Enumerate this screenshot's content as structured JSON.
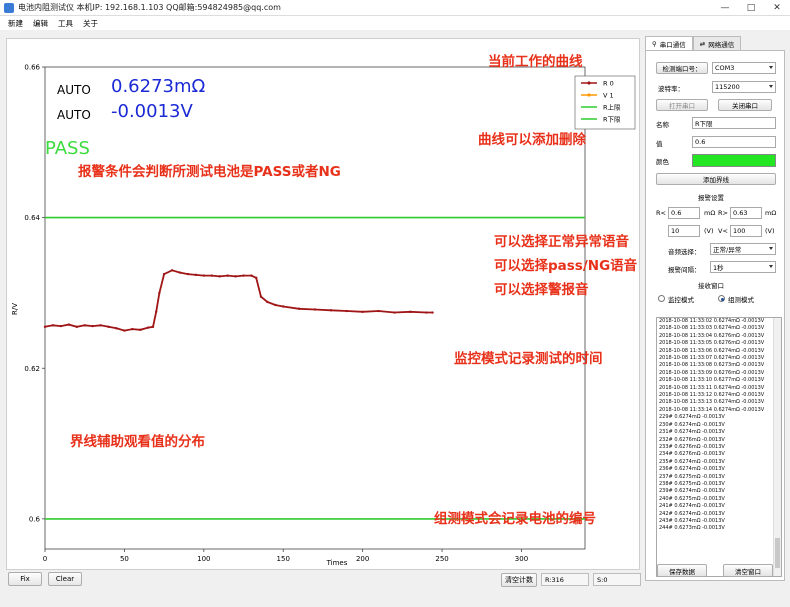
{
  "window": {
    "title": "电池内阻测试仪  本机IP: 192.168.1.103  QQ邮箱:594824985@qq.com",
    "controls": [
      "—",
      "□",
      "✕"
    ]
  },
  "menu": [
    "新建",
    "编辑",
    "工具",
    "关于"
  ],
  "readout": {
    "mode1": "AUTO",
    "value1": "0.6273mΩ",
    "mode2": "AUTO",
    "value2": "-0.0013V",
    "status": "PASS",
    "status_color": "#3ddc3d",
    "value_color": "#1c2ad6"
  },
  "legend": [
    "R 0",
    "V 1",
    "R上限",
    "R下限"
  ],
  "chart_data": {
    "type": "line",
    "xlabel": "Times",
    "ylabel": "R/V",
    "xlim": [
      0,
      340
    ],
    "ylim": [
      0.596,
      0.66
    ],
    "xticks": [
      "0",
      "50",
      "100",
      "150",
      "200",
      "250",
      "300"
    ],
    "yticks": [
      "0.66",
      "0.64",
      "0.62",
      "0.6"
    ],
    "series": [
      {
        "name": "R 0",
        "color": "#a01515",
        "x": [
          0,
          5,
          10,
          15,
          20,
          25,
          30,
          35,
          40,
          45,
          50,
          55,
          60,
          65,
          68,
          70,
          72,
          75,
          80,
          85,
          90,
          95,
          100,
          105,
          110,
          115,
          120,
          125,
          130,
          133,
          136,
          140,
          145,
          150,
          160,
          170,
          180,
          190,
          200,
          210,
          220,
          230,
          240,
          244
        ],
        "y": [
          0.6255,
          0.6257,
          0.6256,
          0.6258,
          0.6255,
          0.6257,
          0.6256,
          0.6257,
          0.6255,
          0.6253,
          0.625,
          0.6252,
          0.6251,
          0.6254,
          0.6255,
          0.6275,
          0.63,
          0.6325,
          0.633,
          0.6327,
          0.6325,
          0.6324,
          0.6323,
          0.6323,
          0.6322,
          0.6323,
          0.6322,
          0.6323,
          0.6323,
          0.632,
          0.6295,
          0.6288,
          0.6284,
          0.6282,
          0.6279,
          0.6278,
          0.6277,
          0.6276,
          0.6275,
          0.6276,
          0.6274,
          0.6275,
          0.6274,
          0.6274
        ]
      },
      {
        "name": "V 1",
        "color": "#ff9900",
        "x": [],
        "y": []
      },
      {
        "name": "R上限",
        "color": "#2ecc2e",
        "x": [
          0,
          340
        ],
        "y": [
          0.64,
          0.64
        ]
      },
      {
        "name": "R下限",
        "color": "#2ecc2e",
        "x": [
          0,
          340
        ],
        "y": [
          0.6,
          0.6
        ]
      }
    ],
    "grid": false,
    "legend_position": "top-right"
  },
  "annotations": {
    "curve": "当前工作的曲线",
    "add_remove": "曲线可以添加删除",
    "alarm": "报警条件会判断所测试电池是PASS或者NG",
    "voice1": "可以选择正常异常语音",
    "voice2": "可以选择pass/NG语音",
    "voice3": "可以选择警报音",
    "monitor": "监控模式记录测试的时间",
    "boundary": "界线辅助观看值的分布",
    "group": "组测模式会记录电池的编号"
  },
  "bottom": {
    "fix": "Fix",
    "clear": "Clear",
    "clear_count": "清空计数",
    "r_count": "R:316",
    "s_count": "S:0"
  },
  "right": {
    "tab_serial": "串口通信",
    "tab_net": "网络通信",
    "detect_port_label": "检测端口号：",
    "port_value": "COM3",
    "baud_label": "波特率：",
    "baud_value": "115200",
    "open_port": "打开串口",
    "close_port": "关闭串口",
    "name_label": "名称",
    "name_value": "R下限",
    "value_label": "值",
    "value_value": "0.6",
    "color_label": "颜色",
    "color_value": "#22e622",
    "add_boundary": "添加界线",
    "alarm_settings": "报警设置",
    "r_lt": "R<",
    "r_lt_value": "0.6",
    "r_gt": "R>",
    "r_gt_value": "0.63",
    "unit_mohm": "mΩ",
    "v_lt_value": "10",
    "unit_v": "(V)",
    "v_lt2": "V<",
    "v_gt_value": "100",
    "unit_v2": "(V)",
    "voice_label": "音频选择：",
    "voice_value": "正常/异常",
    "interval_label": "报警间隔：",
    "interval_value": "1秒",
    "recv_window": "接收窗口",
    "mode_monitor": "监控模式",
    "mode_group": "组测模式",
    "log_lines": [
      "2018-10-08 11:33:02  0.6274mΩ  -0.0013V",
      "2018-10-08 11:33:03  0.6274mΩ  -0.0013V",
      "2018-10-08 11:33:04  0.6276mΩ  -0.0013V",
      "2018-10-08 11:33:05  0.6276mΩ  -0.0013V",
      "2018-10-08 11:33:06  0.6274mΩ  -0.0013V",
      "2018-10-08 11:33:07  0.6274mΩ  -0.0013V",
      "2018-10-08 11:33:08  0.6273mΩ  -0.0013V",
      "2018-10-08 11:33:09  0.6276mΩ  -0.0013V",
      "2018-10-08 11:33:10  0.6277mΩ  -0.0013V",
      "2018-10-08 11:33:11  0.6274mΩ  -0.0013V",
      "2018-10-08 11:33:12  0.6274mΩ  -0.0013V",
      "2018-10-08 11:33:13  0.6274mΩ  -0.0013V",
      "2018-10-08 11:33:14  0.6274mΩ  -0.0013V",
      "229#  0.6274mΩ  -0.0013V",
      "230#  0.6274mΩ  -0.0013V",
      "231#  0.6274mΩ  -0.0013V",
      "232#  0.6276mΩ  -0.0013V",
      "233#  0.6276mΩ  -0.0013V",
      "234#  0.6276mΩ  -0.0013V",
      "235#  0.6274mΩ  -0.0013V",
      "236#  0.6274mΩ  -0.0013V",
      "237#  0.6275mΩ  -0.0013V",
      "238#  0.6275mΩ  -0.0013V",
      "239#  0.6274mΩ  -0.0013V",
      "240#  0.6275mΩ  -0.0013V",
      "241#  0.6274mΩ  -0.0013V",
      "242#  0.6274mΩ  -0.0013V",
      "243#  0.6274mΩ  -0.0013V",
      "244#  0.6273mΩ  -0.0013V"
    ],
    "save_data": "保存数据",
    "clear_window": "清空窗口"
  }
}
